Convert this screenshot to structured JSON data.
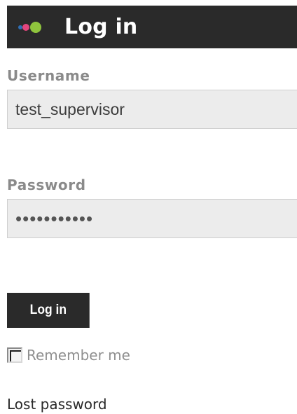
{
  "header": {
    "title": "Log in",
    "logo_colors": [
      "#2f6fb5",
      "#e2457d",
      "#8fc43d"
    ]
  },
  "form": {
    "username_label": "Username",
    "username_value": "test_supervisor",
    "password_label": "Password",
    "password_value": "•••••••••••",
    "submit_label": "Log in",
    "remember_label": "Remember me",
    "remember_checked": false,
    "lost_password_label": "Lost password"
  },
  "colors": {
    "header_bg": "#2a2a2a",
    "label_gray": "#8a8a8a",
    "input_bg": "#ececec"
  }
}
